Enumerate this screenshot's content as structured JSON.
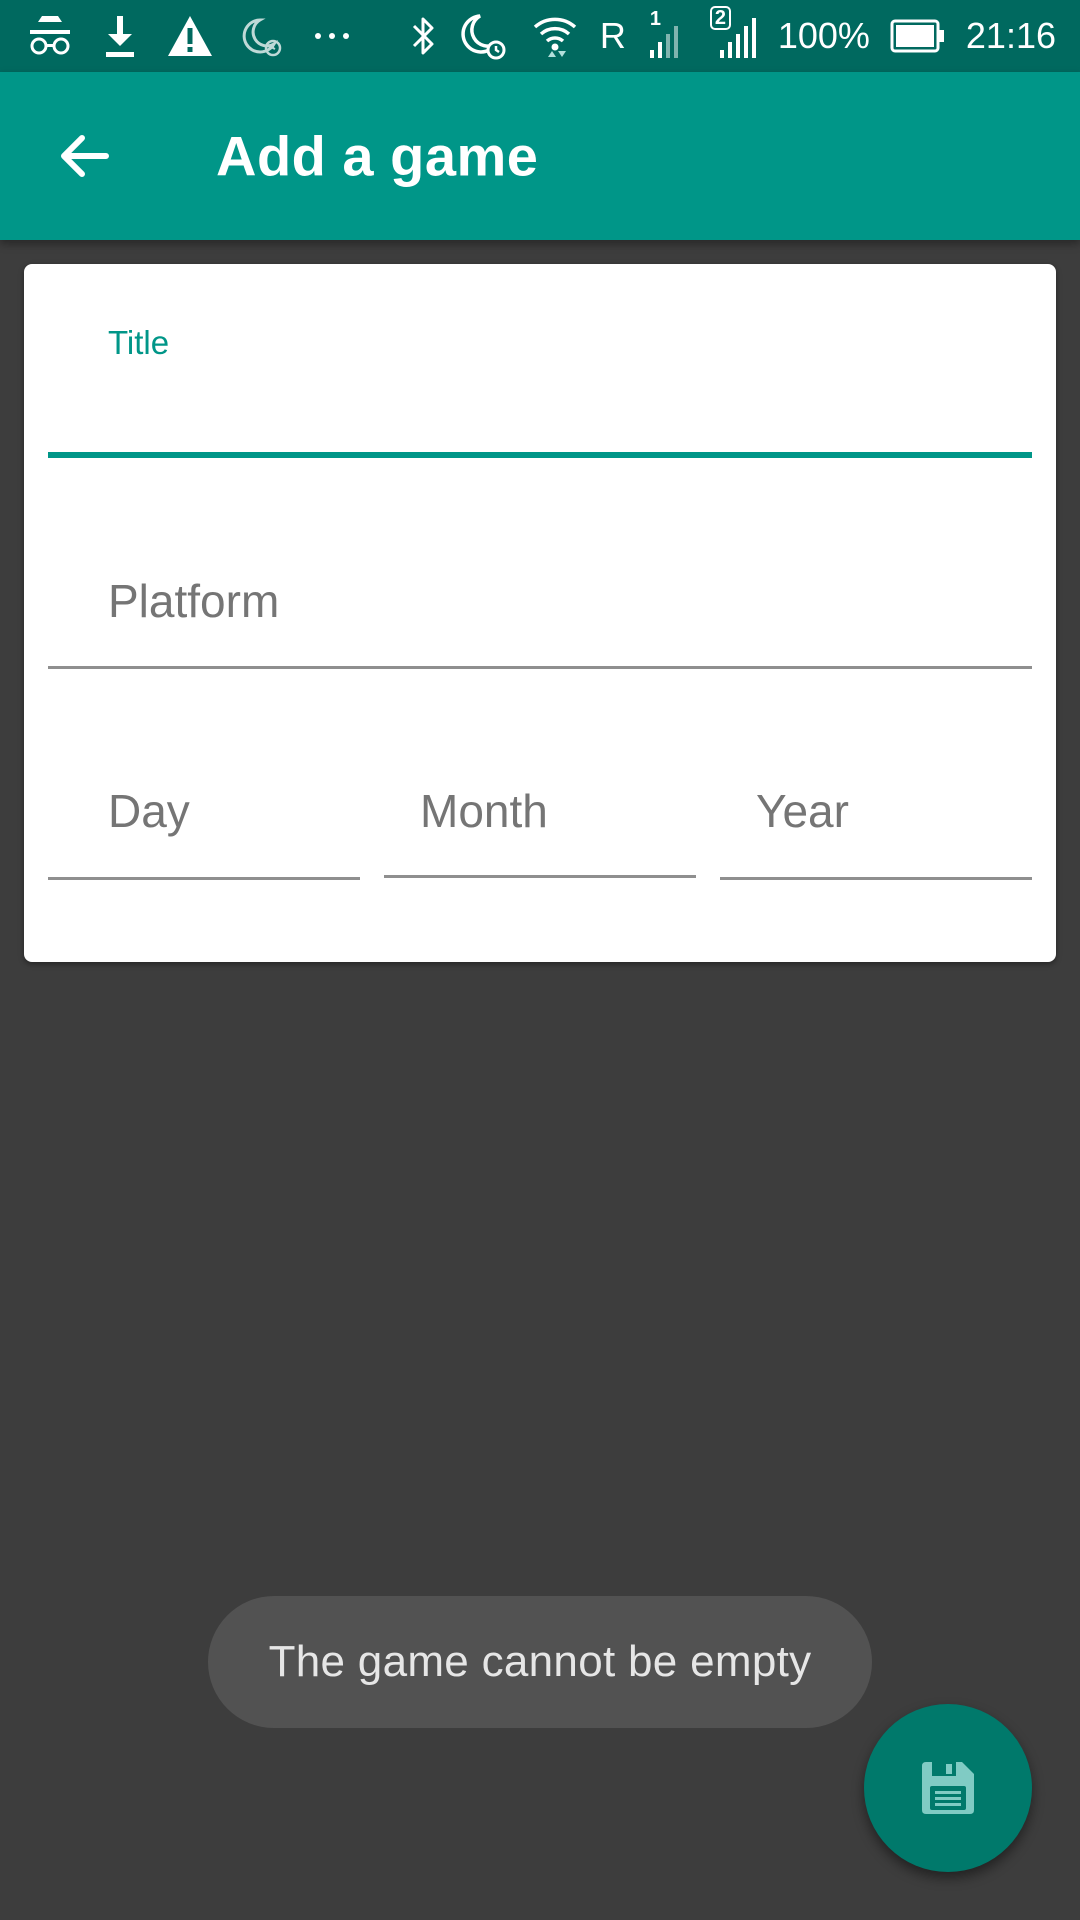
{
  "status_bar": {
    "icons": [
      "incognito-icon",
      "download-icon",
      "warning-icon",
      "night-alarm-icon",
      "more-dots-icon",
      "bluetooth-icon",
      "night-alarm-icon",
      "wifi-icon",
      "signal-sim1-icon",
      "signal-sim2-icon",
      "battery-icon"
    ],
    "roaming_label": "R",
    "sim1_label": "1",
    "sim2_label": "2",
    "battery_percent": "100%",
    "time": "21:16"
  },
  "app_bar": {
    "title": "Add a game",
    "back_icon": "arrow-left-icon"
  },
  "form": {
    "title_label": "Title",
    "title_value": "",
    "platform_label": "Platform",
    "platform_value": "",
    "day_label": "Day",
    "day_value": "",
    "month_label": "Month",
    "month_value": "",
    "year_label": "Year",
    "year_value": ""
  },
  "toast": {
    "message": "The game cannot be empty"
  },
  "fab": {
    "icon": "save-icon"
  },
  "colors": {
    "primary": "#009688",
    "primary_dark": "#00695f",
    "fab": "#00796b",
    "background": "#3d3d3d",
    "toast_bg": "#525252"
  }
}
